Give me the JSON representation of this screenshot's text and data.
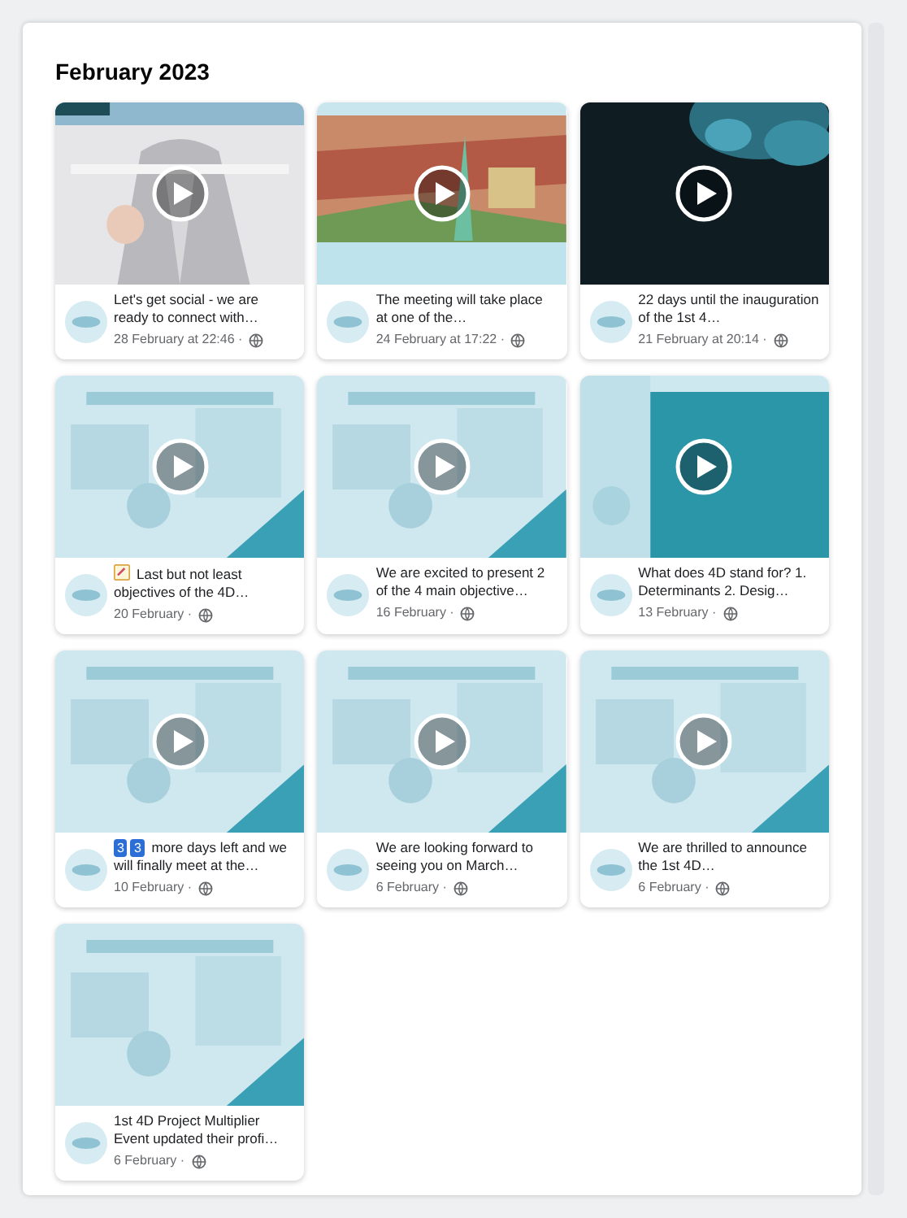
{
  "heading": "February 2023",
  "posts": [
    {
      "kind": "picture",
      "video": true,
      "caption": "Let's get social - we are ready to connect with…",
      "date": "28 February at 22:46 ·"
    },
    {
      "kind": "picture",
      "video": true,
      "caption": "The meeting will take place at one of the…",
      "date": "24 February at 17:22 ·"
    },
    {
      "kind": "picture",
      "video": true,
      "caption": "22 days until the inauguration of the 1st 4…",
      "date": "21 February at 20:14 ·"
    },
    {
      "kind": "picture",
      "video": true,
      "note_icon": true,
      "caption": "Last but not least objectives of the 4D…",
      "date": "20 February ·"
    },
    {
      "kind": "picture",
      "video": true,
      "caption": "We are excited to present 2 of the 4 main objective…",
      "date": "16 February ·"
    },
    {
      "kind": "picture",
      "video": true,
      "caption": "What does 4D stand for? 1. Determinants 2. Desig…",
      "date": "13 February ·"
    },
    {
      "kind": "picture",
      "video": true,
      "keycaps": [
        "3",
        "3"
      ],
      "caption": "more days left and we will finally meet at the…",
      "date": "10 February ·"
    },
    {
      "kind": "picture",
      "video": true,
      "caption": "We are looking forward to seeing you on March…",
      "date": "6 February ·"
    },
    {
      "kind": "picture",
      "video": true,
      "caption": "We are thrilled to announce the 1st 4D…",
      "date": "6 February ·"
    },
    {
      "kind": "picture",
      "video": false,
      "caption": "1st 4D Project Multiplier Event updated their profi…",
      "date": "6 February ·"
    }
  ]
}
